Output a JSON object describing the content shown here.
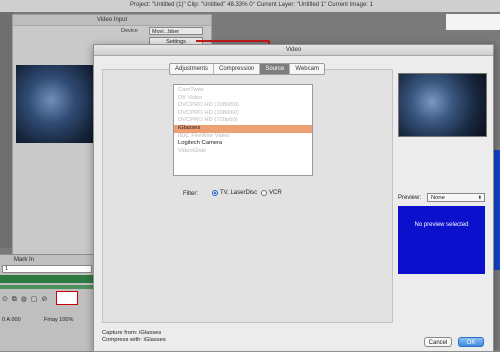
{
  "topbar": {
    "text": "Project: \"Untitled (1)\"  Clip: \"Untitled\"  48.33%  0°  Current Layer: \"Untitled 1\"  Current Image: 1"
  },
  "video_input": {
    "title": "Video Input",
    "device_label": "Device",
    "device_value": "Movi...bber",
    "settings_button": "Settings"
  },
  "timeline": {
    "mark_in": "Mark In",
    "field_value": "1",
    "time": "0 A:000",
    "fps": "Fmay  100%"
  },
  "dialog": {
    "title": "Video",
    "tabs": [
      "Adjustments",
      "Compression",
      "Source",
      "Webcam"
    ],
    "active_tab": "Source",
    "sources": [
      {
        "label": "CamTwist",
        "enabled": false
      },
      {
        "label": "DV Video",
        "enabled": false
      },
      {
        "label": "DVCPRO HD (1080i50)",
        "enabled": false
      },
      {
        "label": "DVCPRO HD (1080i60)",
        "enabled": false
      },
      {
        "label": "DVCPRO HD (720p60)",
        "enabled": false
      },
      {
        "label": "iGlasses",
        "enabled": true,
        "selected": true
      },
      {
        "label": "IIDC FireWire Video",
        "enabled": false
      },
      {
        "label": "Logitech Camera",
        "enabled": true
      },
      {
        "label": "VideoGlide",
        "enabled": false
      }
    ],
    "filter_label": "Filter:",
    "filter_options": [
      "TV, LaserDisc",
      "VCR"
    ],
    "filter_selected": "TV, LaserDisc",
    "preview_label": "Preview:",
    "preview_value": "None",
    "no_preview_text": "No preview selected",
    "capture_from": "Capture from: iGlasses",
    "compress_with": "Compress with: iGlasses",
    "cancel_button": "Cancel",
    "ok_button": "OK"
  },
  "colors": {
    "selection": "#ef9f74",
    "connector": "#c21a1a",
    "preview_blue": "#0a10cc",
    "ok_blue": "#3f88df",
    "track_green": "#2e7a40"
  }
}
